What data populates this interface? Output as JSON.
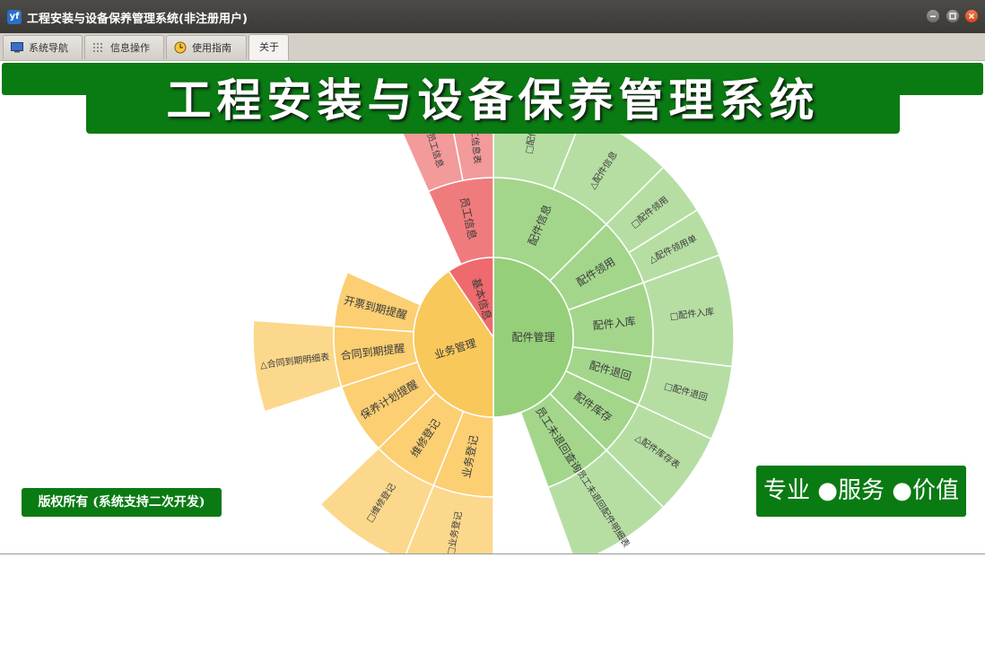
{
  "window": {
    "title": "工程安装与设备保养管理系统(非注册用户)",
    "icon_text": "yf"
  },
  "tabs": [
    {
      "label": "系统导航",
      "icon": "monitor-icon"
    },
    {
      "label": "信息操作",
      "icon": "grid-icon"
    },
    {
      "label": "使用指南",
      "icon": "clock-icon"
    },
    {
      "label": "关于",
      "active": true
    }
  ],
  "banner": {
    "title": "工程安装与设备保养管理系统"
  },
  "footer": {
    "copyright": "版权所有 (系统支持二次开发)",
    "slogan": "专业 ●服务 ●价值"
  },
  "colors": {
    "brand_green": "#0a7a13",
    "parts_green": "#95cf7a",
    "business_yellow": "#f9c85b",
    "basic_red": "#ee6a6d"
  },
  "sunburst": {
    "roots": [
      {
        "label": "配件管理",
        "color": "#95cf7a",
        "children": [
          {
            "label": "配件信息",
            "children": [
              {
                "label": "□配件"
              },
              {
                "label": "△配件信息"
              }
            ]
          },
          {
            "label": "配件领用",
            "children": [
              {
                "label": "□配件领用"
              },
              {
                "label": "△配件领用单"
              }
            ]
          },
          {
            "label": "配件入库",
            "children": [
              {
                "label": "□配件入库"
              }
            ]
          },
          {
            "label": "配件退回",
            "children": [
              {
                "label": "□配件退回"
              }
            ]
          },
          {
            "label": "配件库存",
            "children": [
              {
                "label": "△配件库存表"
              }
            ]
          },
          {
            "label": "员工未退回查询",
            "children": [
              {
                "label": "△员工未退回配件明细表"
              }
            ]
          }
        ]
      },
      {
        "label": "业务管理",
        "color": "#f9c85b",
        "children": [
          {
            "label": "业务登记",
            "children": [
              {
                "label": "□业务登记"
              }
            ]
          },
          {
            "label": "维修登记",
            "children": [
              {
                "label": "□维修登记"
              }
            ]
          },
          {
            "label": "保养计划提醒",
            "children": []
          },
          {
            "label": "合同到期提醒",
            "children": [
              {
                "label": "△合同到期明细表"
              }
            ]
          },
          {
            "label": "开票到期提醒",
            "children": []
          }
        ]
      },
      {
        "label": "基本信息",
        "color": "#ee6a6d",
        "children": [
          {
            "label": "员工信息",
            "children": [
              {
                "label": "□员工信息"
              },
              {
                "label": "△员工信息表"
              }
            ]
          }
        ]
      }
    ]
  }
}
